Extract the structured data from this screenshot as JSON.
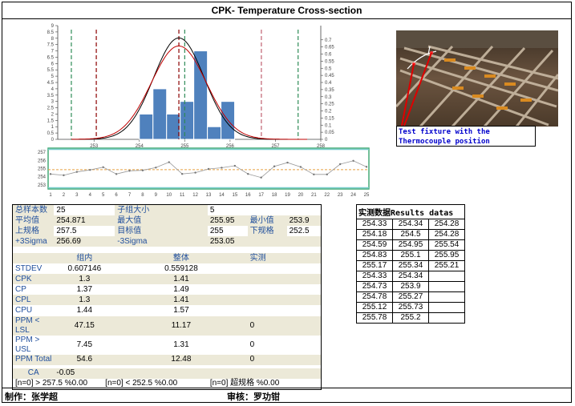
{
  "title": "CPK- Temperature Cross-section",
  "footer": {
    "maker": "制作：张学超",
    "reviewer": "审核：罗功钳"
  },
  "photo": {
    "caption": "Test fixture with the Thermocouple position"
  },
  "chart_data": [
    {
      "type": "bar",
      "title": "",
      "bins": [
        254.0,
        254.3,
        254.6,
        254.9,
        255.2,
        255.5,
        255.8
      ],
      "counts": [
        2,
        4,
        2,
        3,
        7,
        1,
        3
      ],
      "xlim": [
        252.2,
        258.0
      ],
      "xticks": [
        "253",
        "254",
        "255",
        "256",
        "257",
        "258"
      ],
      "xtick_values": [
        253,
        254,
        255,
        256,
        257,
        258
      ],
      "ylim_left": [
        0,
        9
      ],
      "yticks_left": [
        "0",
        "0.5",
        "1",
        "1.5",
        "2",
        "2.5",
        "3",
        "3.5",
        "4",
        "4.5",
        "5",
        "5.5",
        "6",
        "6.5",
        "7",
        "7.5",
        "8",
        "8.5",
        "9"
      ],
      "ylim_right": [
        0,
        0.8
      ],
      "yticks_right": [
        "0",
        "0.05",
        "0.1",
        "0.15",
        "0.2",
        "0.25",
        "0.3",
        "0.35",
        "0.4",
        "0.45",
        "0.5",
        "0.55",
        "0.6",
        "0.65",
        "0.7"
      ],
      "curves": [
        {
          "mean": 254.871,
          "sigma": 0.559128,
          "color": "#000000"
        },
        {
          "mean": 254.871,
          "sigma": 0.607146,
          "color": "#c00000"
        }
      ],
      "vlines": [
        {
          "x": 252.5,
          "color": "#2e8b57"
        },
        {
          "x": 253.05,
          "color": "#8b0000"
        },
        {
          "x": 254.871,
          "color": "#8b0000"
        },
        {
          "x": 255,
          "color": "#2e8b57"
        },
        {
          "x": 256.69,
          "color": "#c06070"
        },
        {
          "x": 257.5,
          "color": "#2e8b57"
        }
      ],
      "bar_color": "#4f81bd"
    },
    {
      "type": "line",
      "title": "",
      "x": [
        1,
        2,
        3,
        4,
        5,
        6,
        7,
        8,
        9,
        10,
        11,
        12,
        13,
        14,
        15,
        16,
        17,
        18,
        19,
        20,
        21,
        22,
        23,
        24,
        25
      ],
      "values": [
        254.33,
        254.18,
        254.59,
        254.83,
        255.17,
        254.33,
        254.73,
        254.78,
        255.12,
        255.78,
        254.34,
        254.5,
        254.95,
        255.1,
        255.34,
        254.34,
        253.9,
        255.27,
        255.73,
        255.2,
        254.28,
        254.28,
        255.54,
        255.95,
        255.21
      ],
      "ylim": [
        252.5,
        257.5
      ],
      "yticks": [
        "253",
        "254",
        "255",
        "256",
        "257"
      ],
      "ytick_values": [
        253,
        254,
        255,
        256,
        257
      ],
      "xticks": [
        "1",
        "2",
        "3",
        "4",
        "5",
        "6",
        "7",
        "8",
        "9",
        "10",
        "11",
        "12",
        "13",
        "14",
        "15",
        "16",
        "17",
        "18",
        "19",
        "20",
        "21",
        "22",
        "23",
        "24",
        "25"
      ],
      "center": 254.871,
      "ucl": 257.5,
      "lcl": 252.5
    }
  ],
  "stats": {
    "n_label": "总样本数",
    "n": "25",
    "subgroup_label": "子组大小",
    "subgroup": "5",
    "mean_label": "平均值",
    "mean": "254.871",
    "max_label": "最大值",
    "max": "255.95",
    "min_label": "最小值",
    "min": "253.9",
    "usl_label": "上规格",
    "usl": "257.5",
    "target_label": "目标值",
    "target": "255",
    "lsl_label": "下规格",
    "lsl": "252.5",
    "p3_label": "+3Sigma",
    "p3": "256.69",
    "m3_label": "-3Sigma",
    "m3": "253.05",
    "col_within": "组内",
    "col_overall": "整体",
    "col_actual": "实测",
    "rows": [
      {
        "label": "STDEV",
        "within": "0.607146",
        "overall": "0.559128",
        "actual": ""
      },
      {
        "label": "CPK",
        "within": "1.3",
        "overall": "1.41",
        "actual": ""
      },
      {
        "label": "CP",
        "within": "1.37",
        "overall": "1.49",
        "actual": ""
      },
      {
        "label": "CPL",
        "within": "1.3",
        "overall": "1.41",
        "actual": ""
      },
      {
        "label": "CPU",
        "within": "1.44",
        "overall": "1.57",
        "actual": ""
      }
    ],
    "ppm_lsl_label": "PPM < LSL",
    "ppm_lsl_within": "47.15",
    "ppm_lsl_overall": "11.17",
    "ppm_lsl_actual": "0",
    "ppm_usl_label": "PPM > USL",
    "ppm_usl_within": "7.45",
    "ppm_usl_overall": "1.31",
    "ppm_usl_actual": "0",
    "ppm_total_label": "PPM Total",
    "ppm_total_within": "54.6",
    "ppm_total_overall": "12.48",
    "ppm_total_actual": "0",
    "ca_label": "CA",
    "ca": "-0.05",
    "f1": "[n=0] > 257.5  %0.00",
    "f2": "[n=0] < 252.5  %0.00",
    "f3": "[n=0] 超规格  %0.00"
  },
  "results": {
    "header": "实测数据Results datas",
    "rows": [
      [
        "254.33",
        "254.34",
        "254.28"
      ],
      [
        "254.18",
        "254.5",
        "254.28"
      ],
      [
        "254.59",
        "254.95",
        "255.54"
      ],
      [
        "254.83",
        "255.1",
        "255.95"
      ],
      [
        "255.17",
        "255.34",
        "255.21"
      ],
      [
        "254.33",
        "254.34",
        ""
      ],
      [
        "254.73",
        "253.9",
        ""
      ],
      [
        "254.78",
        "255.27",
        ""
      ],
      [
        "255.12",
        "255.73",
        ""
      ],
      [
        "255.78",
        "255.2",
        ""
      ]
    ]
  }
}
